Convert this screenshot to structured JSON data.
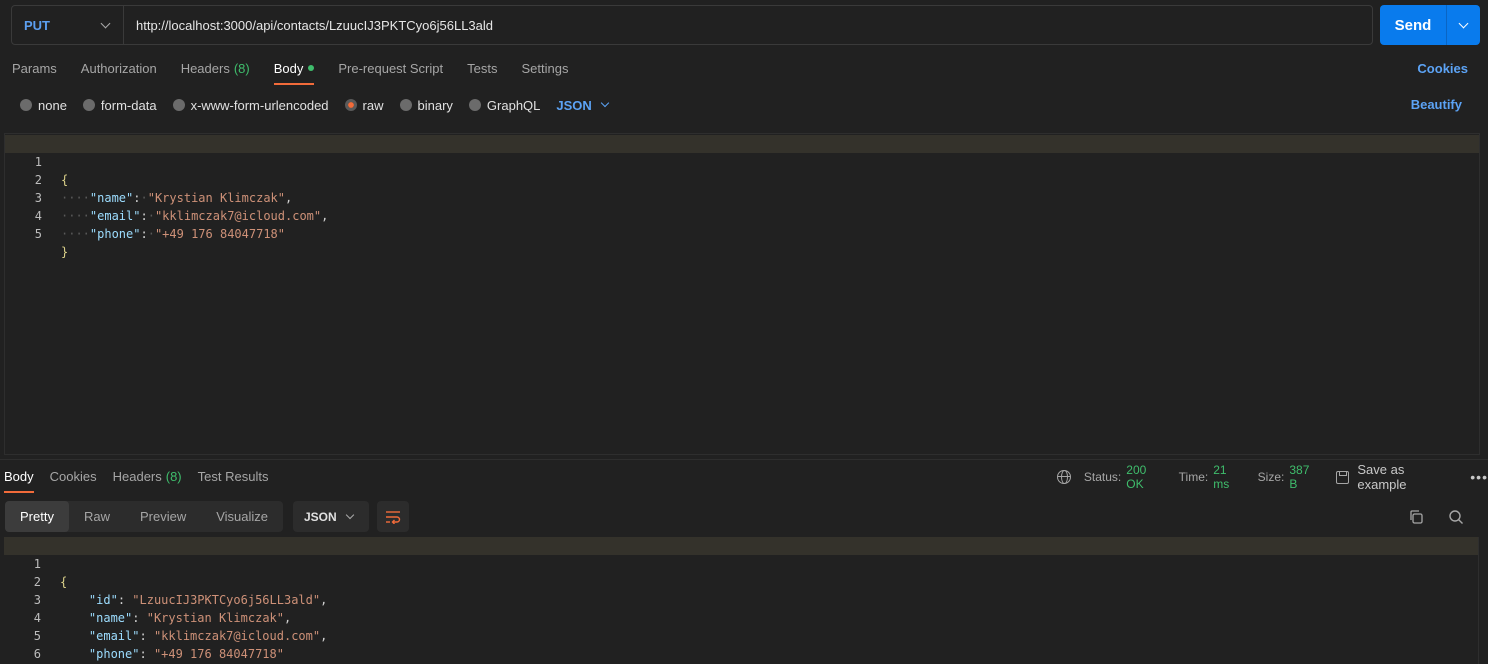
{
  "request": {
    "method": "PUT",
    "url": "http://localhost:3000/api/contacts/LzuucIJ3PKTCyo6j56LL3ald",
    "send_label": "Send"
  },
  "request_tabs": [
    {
      "label": "Params"
    },
    {
      "label": "Authorization"
    },
    {
      "label": "Headers",
      "count": "(8)"
    },
    {
      "label": "Body",
      "active": true
    },
    {
      "label": "Pre-request Script"
    },
    {
      "label": "Tests"
    },
    {
      "label": "Settings"
    }
  ],
  "cookies_label": "Cookies",
  "body_types": [
    "none",
    "form-data",
    "x-www-form-urlencoded",
    "raw",
    "binary",
    "GraphQL"
  ],
  "selected_body_type": "raw",
  "body_format": "JSON",
  "beautify_label": "Beautify",
  "request_body_lines": [
    {
      "n": "1",
      "text": "{"
    },
    {
      "n": "2",
      "key": "\"name\"",
      "val": "\"Krystian Klimczak\"",
      "tail": ","
    },
    {
      "n": "3",
      "key": "\"email\"",
      "val": "\"kklimczak7@icloud.com\"",
      "tail": ","
    },
    {
      "n": "4",
      "key": "\"phone\"",
      "val": "\"+49 176 84047718\"",
      "tail": ""
    },
    {
      "n": "5",
      "text": "}"
    }
  ],
  "response_tabs": [
    {
      "label": "Body",
      "active": true
    },
    {
      "label": "Cookies"
    },
    {
      "label": "Headers",
      "count": "(8)"
    },
    {
      "label": "Test Results"
    }
  ],
  "response_meta": {
    "status_label": "Status:",
    "status_value": "200 OK",
    "time_label": "Time:",
    "time_value": "21 ms",
    "size_label": "Size:",
    "size_value": "387 B",
    "save_label": "Save as example",
    "more": "•••"
  },
  "response_views": [
    "Pretty",
    "Raw",
    "Preview",
    "Visualize"
  ],
  "response_format": "JSON",
  "response_body_lines": [
    {
      "n": "1",
      "text": "{"
    },
    {
      "n": "2",
      "key": "\"id\"",
      "val": "\"LzuucIJ3PKTCyo6j56LL3ald\"",
      "tail": ","
    },
    {
      "n": "3",
      "key": "\"name\"",
      "val": "\"Krystian Klimczak\"",
      "tail": ","
    },
    {
      "n": "4",
      "key": "\"email\"",
      "val": "\"kklimczak7@icloud.com\"",
      "tail": ","
    },
    {
      "n": "5",
      "key": "\"phone\"",
      "val": "\"+49 176 84047718\"",
      "tail": ""
    },
    {
      "n": "6",
      "text": "}"
    }
  ],
  "colors": {
    "accent": "#f26b3a",
    "send": "#097bed",
    "link": "#5ca3f5",
    "success": "#3fbd6c"
  }
}
